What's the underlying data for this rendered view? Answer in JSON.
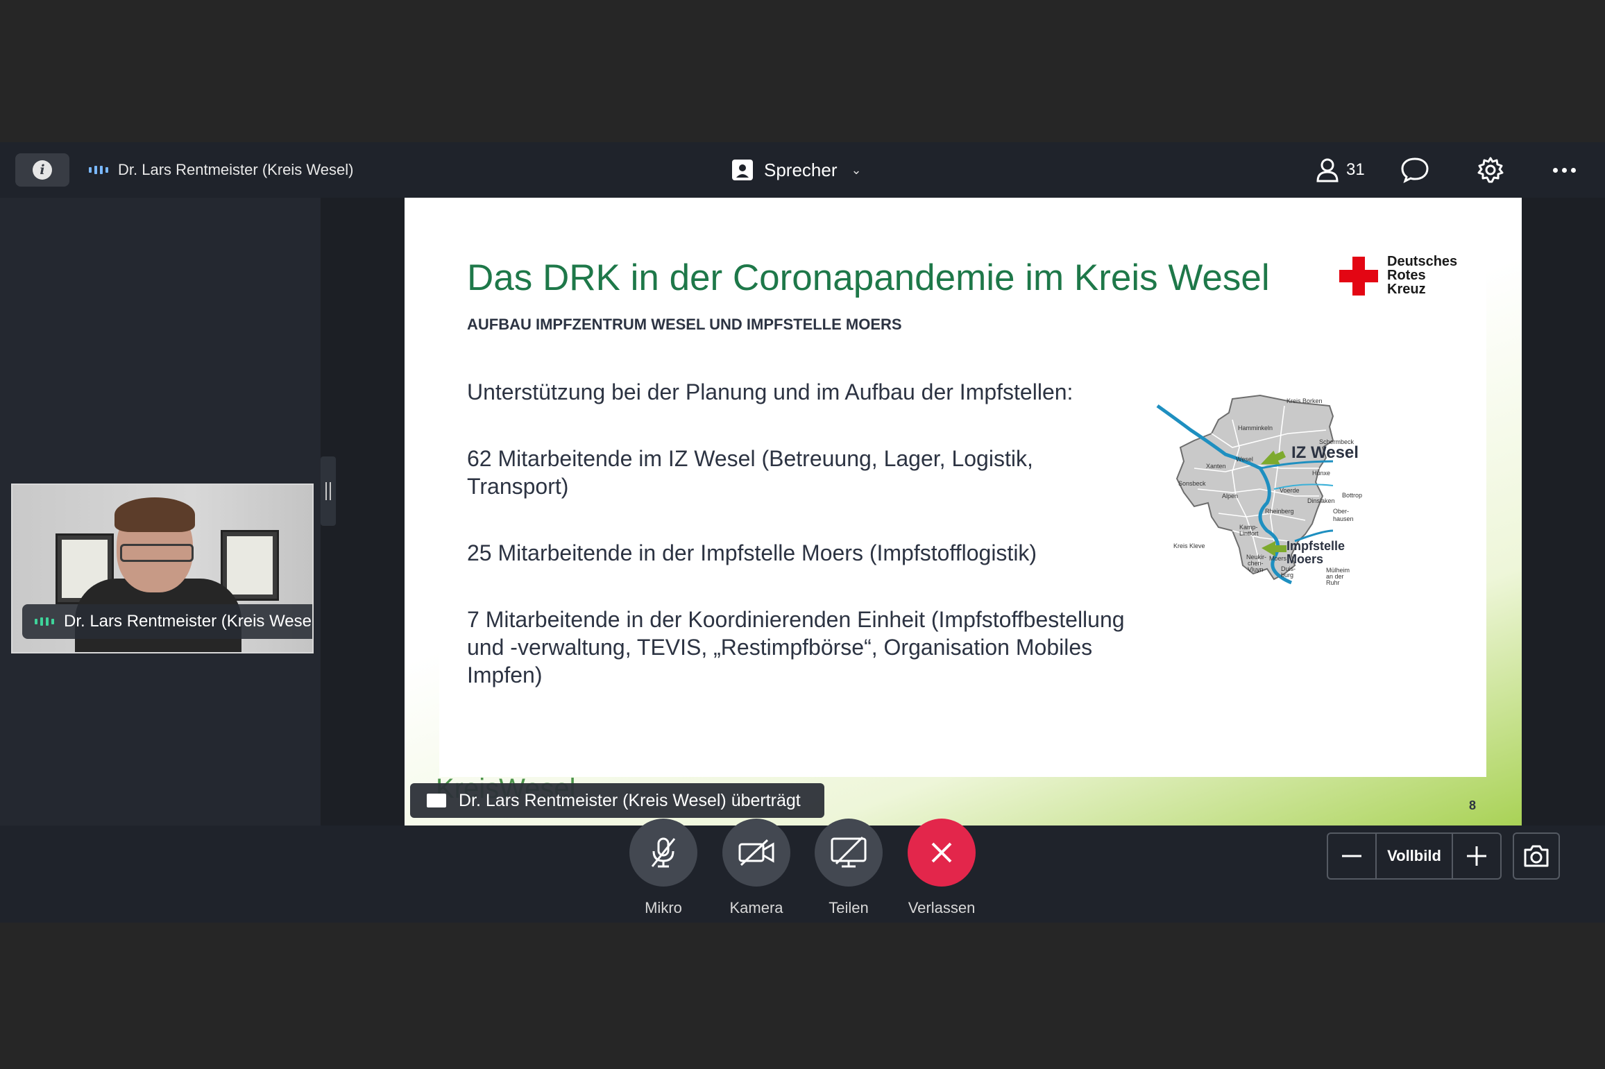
{
  "topbar": {
    "speaker_name": "Dr. Lars Rentmeister (Kreis Wesel)",
    "view_mode": "Sprecher",
    "participant_count": "31"
  },
  "camera_tile": {
    "name_label": "Dr. Lars Rentmeister (Kreis Wesel)"
  },
  "slide": {
    "title": "Das DRK in der Coronapandemie im Kreis Wesel",
    "subtitle": "AUFBAU IMPFZENTRUM WESEL UND IMPFSTELLE MOERS",
    "logo": [
      "Deutsches",
      "Rotes",
      "Kreuz"
    ],
    "bullets": [
      "Unterstützung bei der Planung und im Aufbau der Impfstellen:",
      "62 Mitarbeitende im IZ Wesel (Betreuung, Lager, Logistik, Transport)",
      "25 Mitarbeitende in der Impfstelle Moers (Impfstofflogistik)",
      "7 Mitarbeitende in der Koordinierenden Einheit (Impfstoffbestellung und -verwaltung, TEVIS, „Restimpfbörse“, Organisation Mobiles Impfen)"
    ],
    "map": {
      "callout_1": "IZ Wesel",
      "callout_2_line1": "Impfstelle",
      "callout_2_line2": "Moers",
      "places": [
        "Kreis Borken",
        "Hamminkeln",
        "Schermbeck",
        "Wesel",
        "Xanten",
        "Hünxe",
        "Sonsbeck",
        "Voerde",
        "Bottrop",
        "Alpen",
        "Dinslaken",
        "Ober-",
        "hausen",
        "Rheinberg",
        "Kamp-",
        "Lintfort",
        "Kreis Kleve",
        "Neukir-",
        "chen-",
        "Vluyn",
        "Moers",
        "Duis-",
        "burg",
        "Mülheim",
        "an der",
        "Ruhr"
      ]
    },
    "footer_logo": "KreisWesel",
    "page_number": "8"
  },
  "share_banner": {
    "text": "Dr. Lars Rentmeister (Kreis Wesel) überträgt"
  },
  "controls": {
    "mic_label": "Mikro",
    "camera_label": "Kamera",
    "share_label": "Teilen",
    "leave_label": "Verlassen",
    "leave_color": "#e3264b"
  },
  "zoom": {
    "label": "Vollbild"
  },
  "colors": {
    "title_green": "#1e7849",
    "accent_bars": "#7ab8ff",
    "speaking_bars": "#3fd39a",
    "drk_red": "#e30613"
  }
}
